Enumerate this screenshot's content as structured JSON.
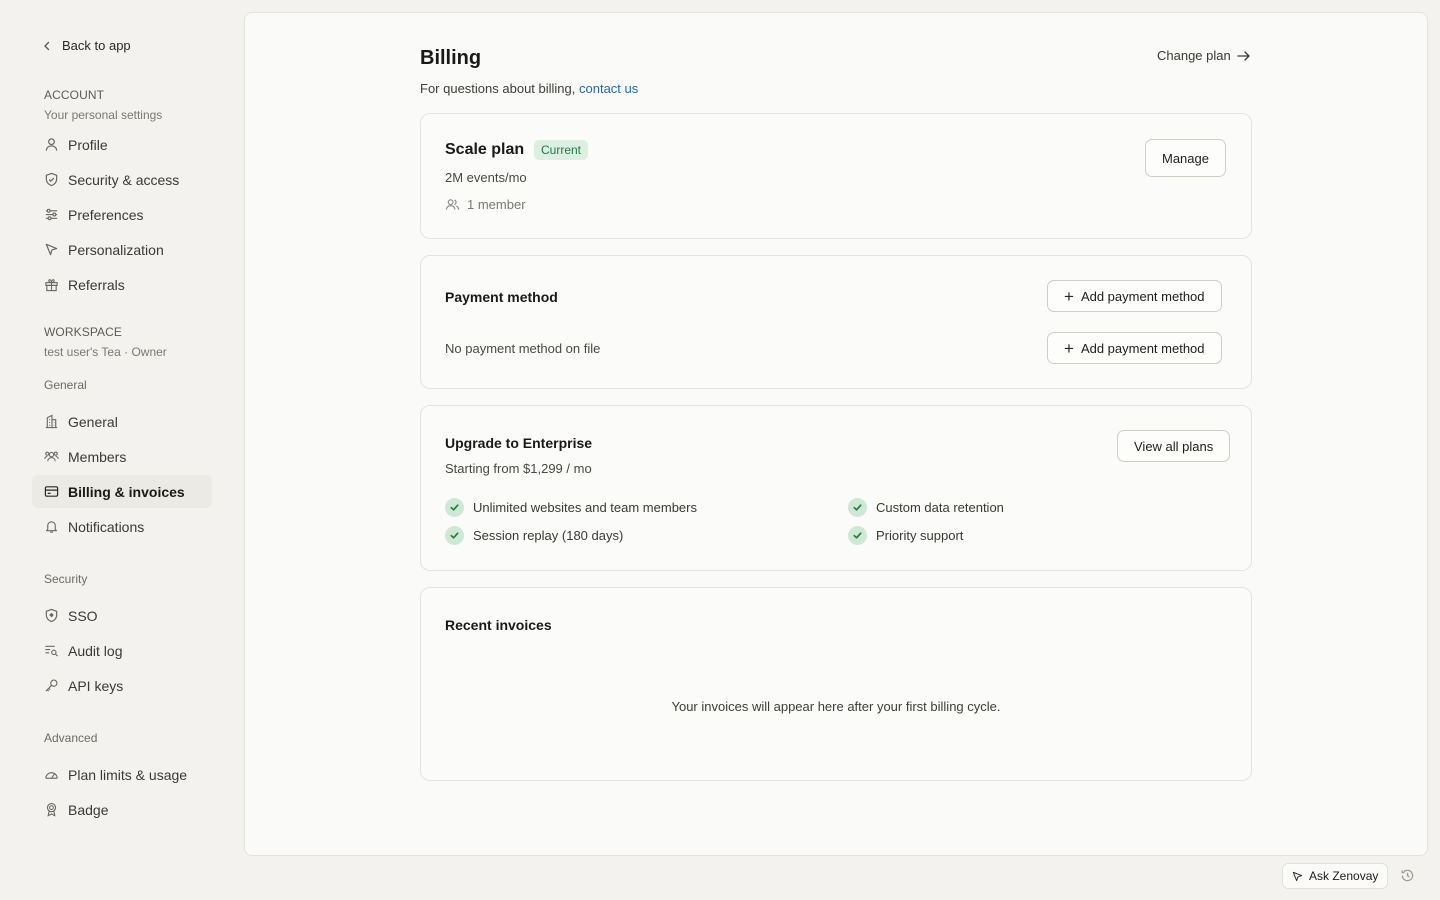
{
  "sidebar": {
    "back_label": "Back to app",
    "account": {
      "title": "ACCOUNT",
      "subtitle": "Your personal settings",
      "items": [
        {
          "label": "Profile",
          "icon": "user-icon"
        },
        {
          "label": "Security & access",
          "icon": "shield-icon"
        },
        {
          "label": "Preferences",
          "icon": "sliders-icon"
        },
        {
          "label": "Personalization",
          "icon": "cursor-icon"
        },
        {
          "label": "Referrals",
          "icon": "gift-icon"
        }
      ]
    },
    "workspace": {
      "title": "WORKSPACE",
      "subtitle": "test user's Tea · Owner",
      "groups": [
        {
          "title": "General",
          "items": [
            {
              "label": "General",
              "icon": "building-icon"
            },
            {
              "label": "Members",
              "icon": "users-icon"
            },
            {
              "label": "Billing & invoices",
              "icon": "credit-card-icon",
              "active": true
            },
            {
              "label": "Notifications",
              "icon": "bell-icon"
            }
          ]
        },
        {
          "title": "Security",
          "items": [
            {
              "label": "SSO",
              "icon": "shield-check-icon"
            },
            {
              "label": "Audit log",
              "icon": "list-search-icon"
            },
            {
              "label": "API keys",
              "icon": "key-icon"
            }
          ]
        },
        {
          "title": "Advanced",
          "items": [
            {
              "label": "Plan limits & usage",
              "icon": "gauge-icon"
            },
            {
              "label": "Badge",
              "icon": "award-icon"
            }
          ]
        }
      ]
    }
  },
  "main": {
    "title": "Billing",
    "subtitle_prefix": "For questions about billing,",
    "contact_link": "contact us",
    "change_plan": "Change plan",
    "plan_card": {
      "name": "Scale plan",
      "badge": "Current",
      "events": "2M events/mo",
      "members": "1 member",
      "manage_button": "Manage"
    },
    "payment_card": {
      "title": "Payment method",
      "add_button": "Add payment method",
      "empty_text": "No payment method on file",
      "add_button_2": "Add payment method"
    },
    "upgrade_card": {
      "title": "Upgrade to Enterprise",
      "price": "Starting from $1,299 / mo",
      "view_plans": "View all plans",
      "features": [
        "Unlimited websites and team members",
        "Custom data retention",
        "Session replay (180 days)",
        "Priority support"
      ]
    },
    "invoices_card": {
      "title": "Recent invoices",
      "empty_text": "Your invoices will appear here after your first billing cycle."
    }
  },
  "footer": {
    "ask_label": "Ask Zenovay"
  },
  "colors": {
    "accent_link": "#2467b5",
    "badge_bg": "#dcefe1",
    "badge_text": "#1f7a44",
    "check_bg": "#cfe8d6"
  }
}
